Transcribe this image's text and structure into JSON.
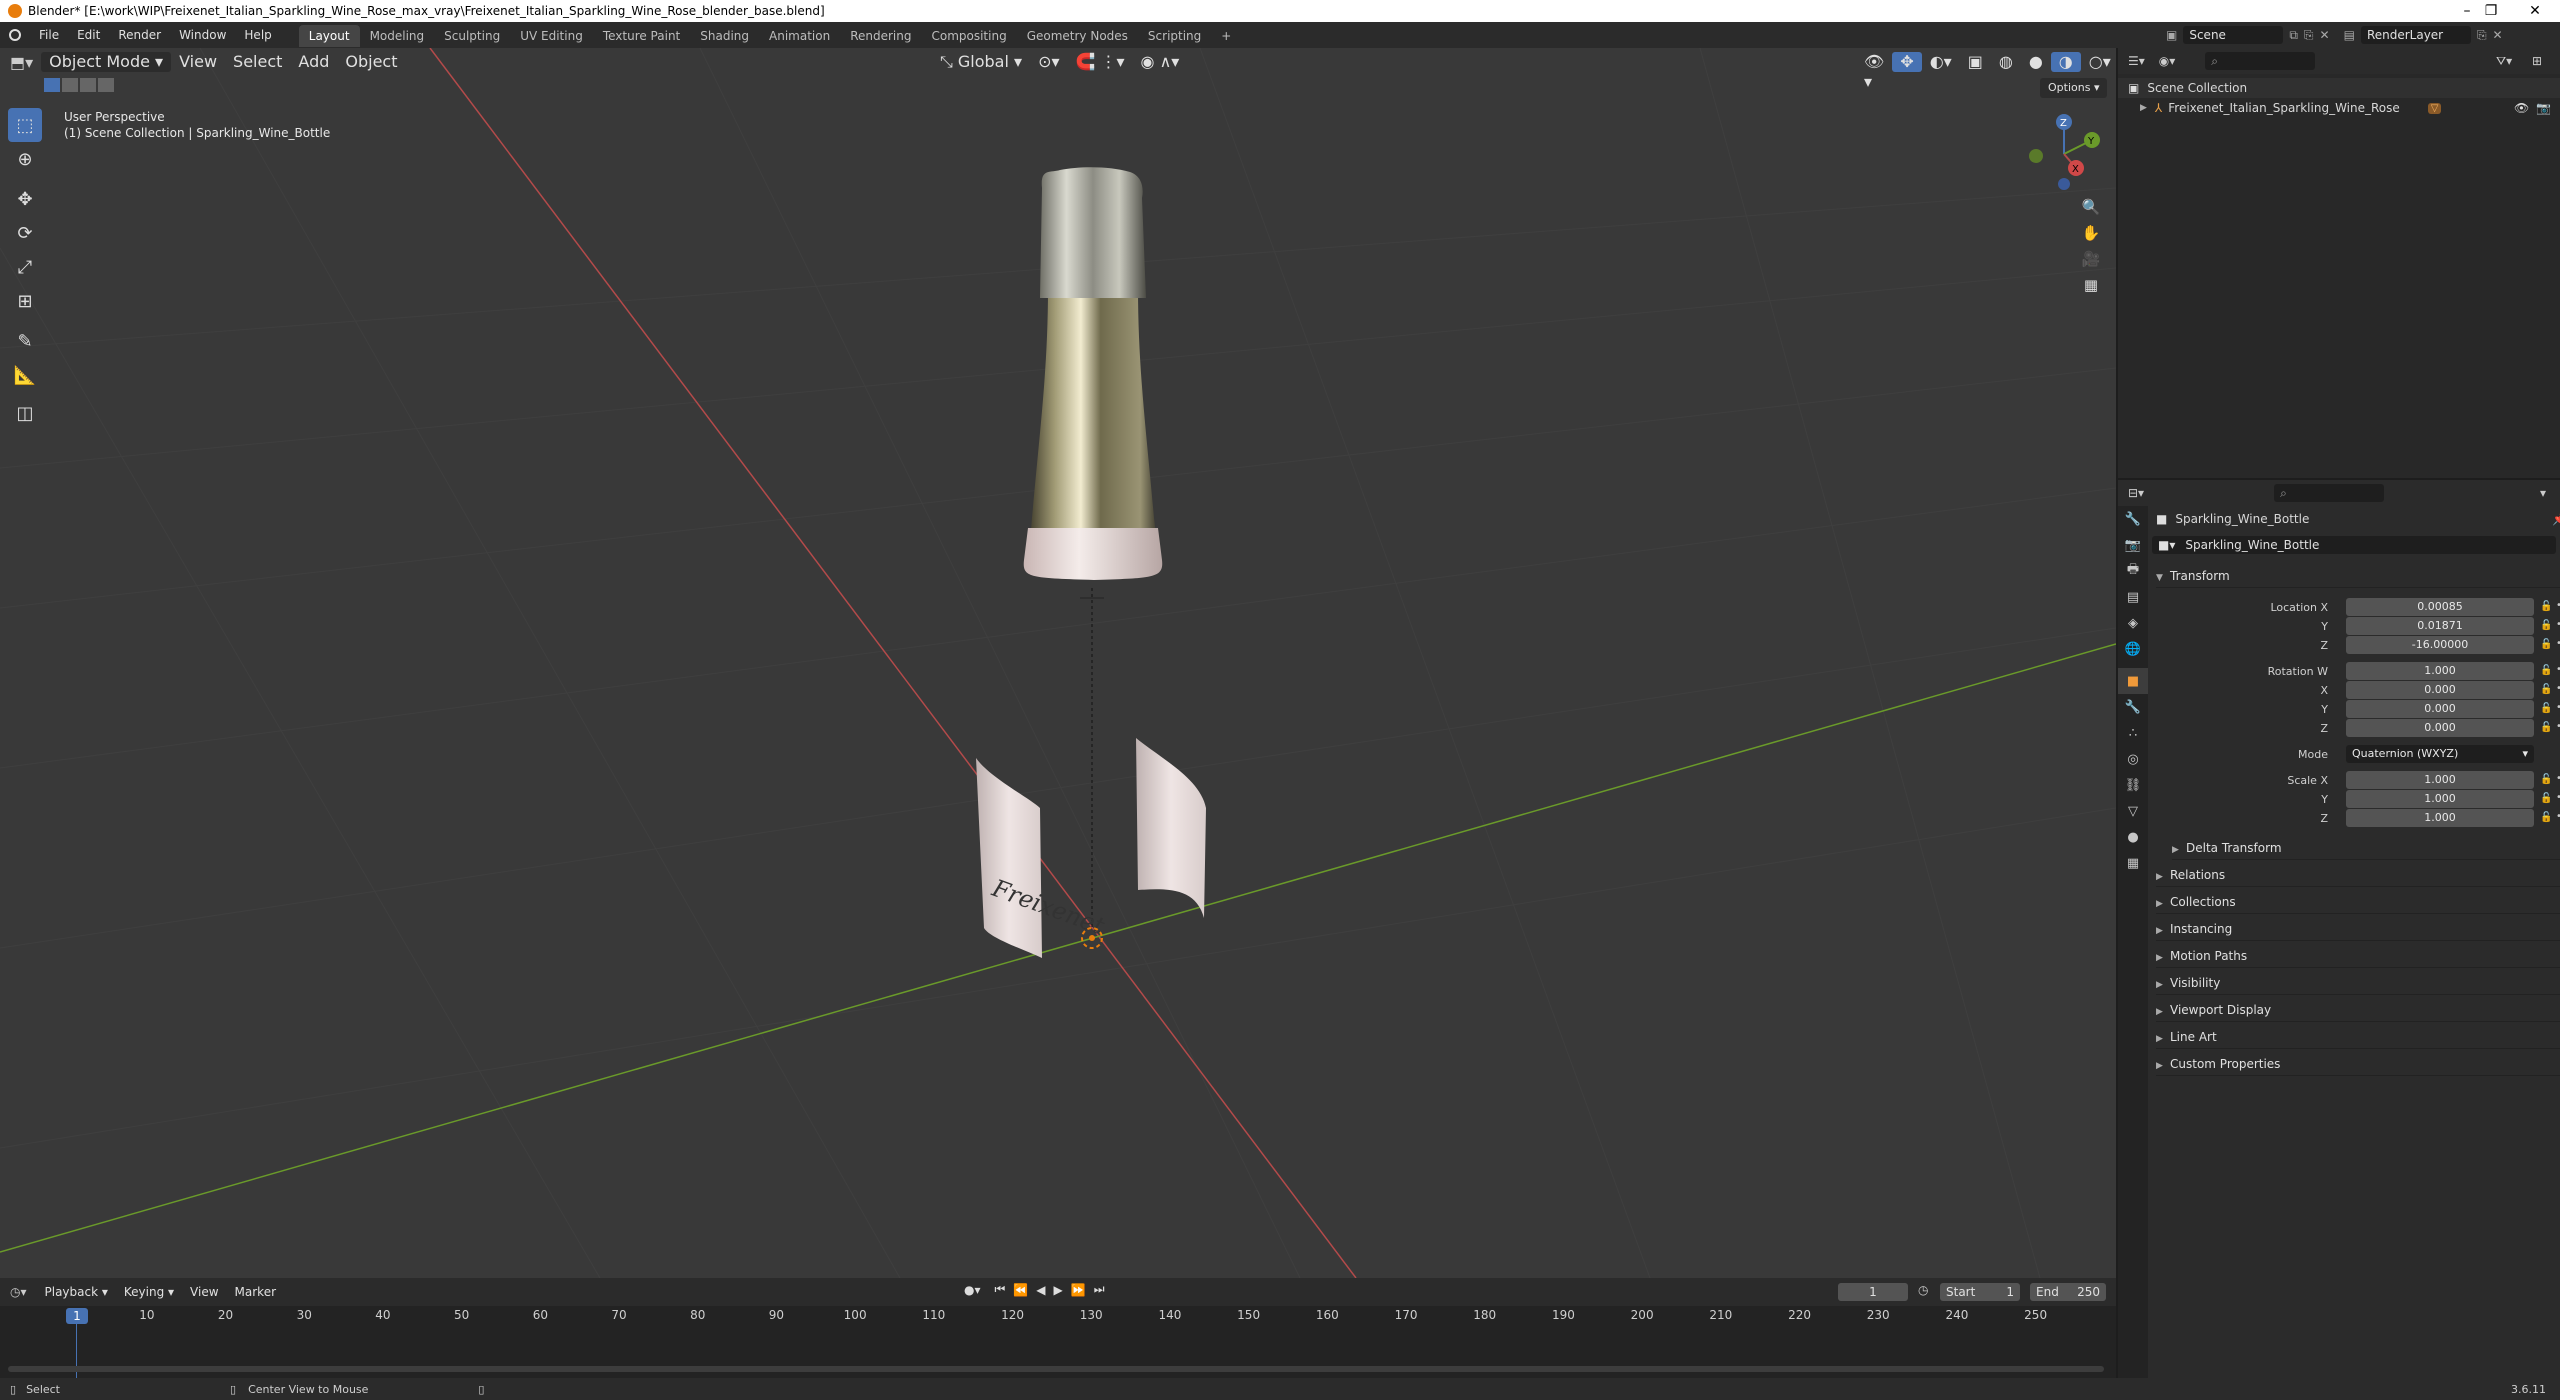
{
  "titlebar": {
    "title": "Blender* [E:\\work\\WIP\\Freixenet_Italian_Sparkling_Wine_Rose_max_vray\\Freixenet_Italian_Sparkling_Wine_Rose_blender_base.blend]",
    "minimize": "–",
    "restore": "❐",
    "close": "✕"
  },
  "menu": [
    "File",
    "Edit",
    "Render",
    "Window",
    "Help"
  ],
  "workspaces": [
    "Layout",
    "Modeling",
    "Sculpting",
    "UV Editing",
    "Texture Paint",
    "Shading",
    "Animation",
    "Rendering",
    "Compositing",
    "Geometry Nodes",
    "Scripting"
  ],
  "active_workspace": "Layout",
  "add_workspace": "+",
  "scene": {
    "name": "Scene",
    "view_layer": "RenderLayer"
  },
  "viewport": {
    "mode": "Object Mode",
    "menus": [
      "View",
      "Select",
      "Add",
      "Object"
    ],
    "transform_orientation": "Global",
    "options_label": "Options",
    "overlay_title": "User Perspective",
    "overlay_subtitle": "(1) Scene Collection | Sparkling_Wine_Bottle",
    "gizmo": {
      "x": "X",
      "y": "Y",
      "z": "Z"
    },
    "tools": [
      "select-box",
      "cursor",
      "move",
      "rotate",
      "scale",
      "transform",
      "annotate",
      "measure",
      "add-cube"
    ],
    "label_text": "Freixenet"
  },
  "timeline": {
    "menus": [
      "Playback",
      "Keying",
      "View",
      "Marker"
    ],
    "current_frame": "1",
    "start_label": "Start",
    "start": "1",
    "end_label": "End",
    "end": "250",
    "ticks": [
      "10",
      "20",
      "30",
      "40",
      "50",
      "60",
      "70",
      "80",
      "90",
      "100",
      "110",
      "120",
      "130",
      "140",
      "150",
      "160",
      "170",
      "180",
      "190",
      "200",
      "210",
      "220",
      "230",
      "240",
      "250"
    ],
    "playhead": "1"
  },
  "outliner": {
    "root": "Scene Collection",
    "object": "Freixenet_Italian_Sparkling_Wine_Rose"
  },
  "properties": {
    "object_name": "Sparkling_Wine_Bottle",
    "datablock": "Sparkling_Wine_Bottle",
    "transform_header": "Transform",
    "location_label": "Location X",
    "location": [
      "0.00085",
      "0.01871",
      "-16.00000"
    ],
    "rotation_label": "Rotation W",
    "rotation": [
      "1.000",
      "0.000",
      "0.000",
      "0.000"
    ],
    "mode_label": "Mode",
    "mode_value": "Quaternion (WXYZ)",
    "scale_label": "Scale X",
    "scale": [
      "1.000",
      "1.000",
      "1.000"
    ],
    "axis_y": "Y",
    "axis_z": "Z",
    "axis_x": "X",
    "delta": "Delta Transform",
    "panels": [
      "Relations",
      "Collections",
      "Instancing",
      "Motion Paths",
      "Visibility",
      "Viewport Display",
      "Line Art",
      "Custom Properties"
    ]
  },
  "status": {
    "select": "Select",
    "center": "Center View to Mouse",
    "version": "3.6.11"
  },
  "colors": {
    "accent": "#4772b3",
    "x_axis": "#b34a4a",
    "y_axis": "#6a9a2a",
    "orange": "#e87d0d"
  }
}
